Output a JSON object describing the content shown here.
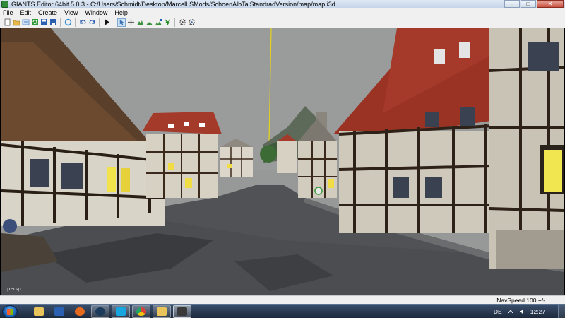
{
  "window": {
    "title": "GIANTS Editor 64bit 5.0.3 - C:/Users/Schmidt/Desktop/MarcelLSMods/SchoenAlbTalStandradVersion/map/map.i3d",
    "minimize_glyph": "–",
    "maximize_glyph": "□",
    "close_glyph": "✕"
  },
  "menu": {
    "items": [
      "File",
      "Edit",
      "Create",
      "View",
      "Window",
      "Help"
    ]
  },
  "toolbar": {
    "buttons": [
      {
        "icon": "new-file-icon",
        "color": "#ffffff"
      },
      {
        "icon": "open-icon",
        "color": "#e8b84a"
      },
      {
        "icon": "import-icon",
        "color": "#4a7fc9"
      },
      {
        "icon": "refresh-icon",
        "color": "#2f9a3a"
      },
      {
        "icon": "save-icon",
        "color": "#2b5fb0"
      },
      {
        "icon": "save-as-icon",
        "color": "#2b5fb0"
      },
      {
        "icon": "reload-icon",
        "color": "#3a8fd0"
      },
      {
        "icon": "undo-icon",
        "color": "#2b5fb0"
      },
      {
        "icon": "redo-icon",
        "color": "#2b5fb0"
      },
      {
        "icon": "play-icon",
        "color": "#111111"
      },
      {
        "icon": "select-icon",
        "color": "#3a6fb0"
      },
      {
        "icon": "move-icon",
        "color": "#666666"
      },
      {
        "icon": "terrain-raise-icon",
        "color": "#3c8f3c"
      },
      {
        "icon": "terrain-smooth-icon",
        "color": "#3c8f3c"
      },
      {
        "icon": "terrain-paint-icon",
        "color": "#3c8f3c"
      },
      {
        "icon": "foliage-paint-icon",
        "color": "#2a8f2a"
      },
      {
        "icon": "settings-gear-icon",
        "color": "#444444"
      },
      {
        "icon": "gear-icon",
        "color": "#444444"
      }
    ]
  },
  "viewport": {
    "camera_label": "persp"
  },
  "statusbar": {
    "nav_speed": "NavSpeed 100 +/-"
  },
  "taskbar": {
    "apps": [
      {
        "icon": "explorer-icon",
        "color": "#e8c45a"
      },
      {
        "icon": "word-icon",
        "color": "#2b5fb0"
      },
      {
        "icon": "firefox-icon",
        "color": "#e66a1e"
      },
      {
        "icon": "steam-icon",
        "color": "#1b3a5c"
      },
      {
        "icon": "skype-icon",
        "color": "#17a6e0"
      },
      {
        "icon": "chrome-icon",
        "color": "#d9423a"
      },
      {
        "icon": "folder-icon",
        "color": "#e8c45a"
      },
      {
        "icon": "giants-editor-icon",
        "color": "#3a3a3a"
      }
    ],
    "language": "DE",
    "clock": "12:27"
  }
}
